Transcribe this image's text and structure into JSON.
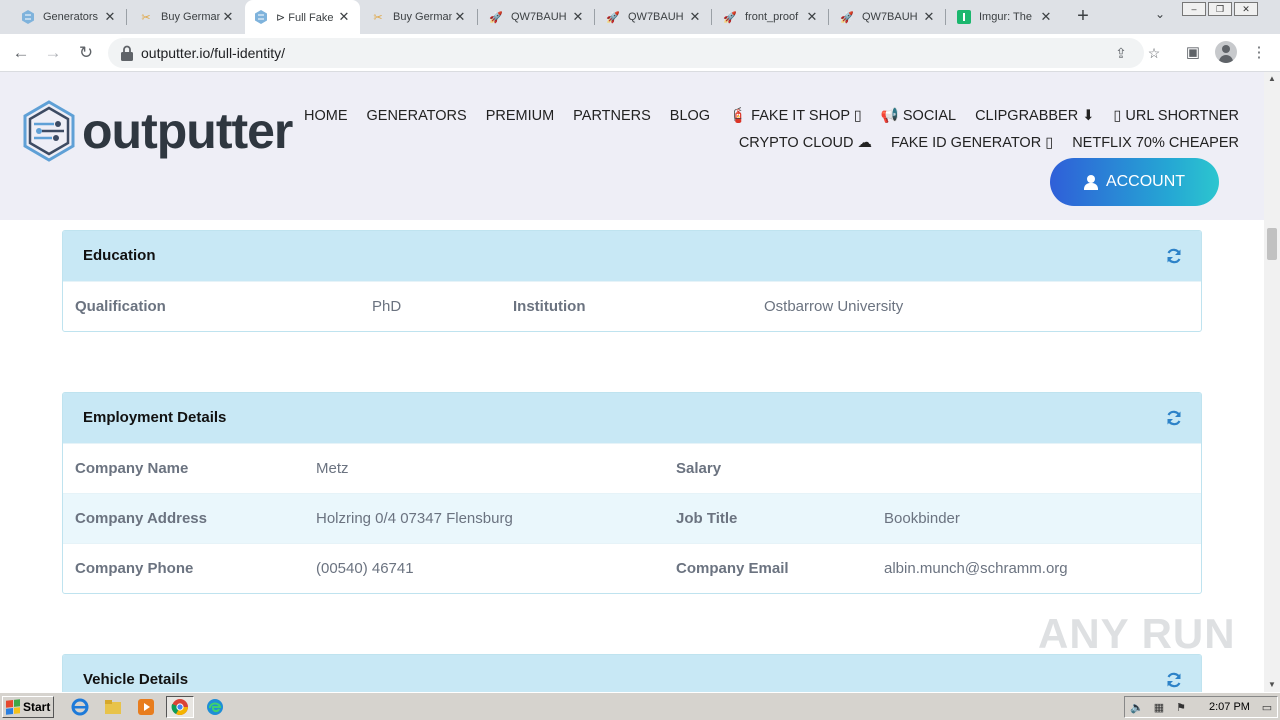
{
  "browser": {
    "tabs": [
      {
        "title": "Generators",
        "favicon": "outputter-icon",
        "active": false
      },
      {
        "title": "Buy German",
        "favicon": "shop-icon",
        "active": false
      },
      {
        "title": "⊳ Full Fake",
        "favicon": "outputter-icon",
        "active": true
      },
      {
        "title": "Buy German",
        "favicon": "shop-icon",
        "active": false
      },
      {
        "title": "QW7BAUH",
        "favicon": "rocket-icon",
        "active": false
      },
      {
        "title": "QW7BAUH",
        "favicon": "rocket-icon",
        "active": false
      },
      {
        "title": "front_proof",
        "favicon": "rocket-icon",
        "active": false
      },
      {
        "title": "QW7BAUH",
        "favicon": "rocket-icon",
        "active": false
      },
      {
        "title": "Imgur: The",
        "favicon": "imgur-icon",
        "active": false
      }
    ],
    "url": "outputter.io/full-identity/"
  },
  "site": {
    "brand": "outputter",
    "nav_row1": [
      "HOME",
      "GENERATORS",
      "PREMIUM",
      "PARTNERS",
      "BLOG",
      "🧯 FAKE IT SHOP ▯",
      "📢 SOCIAL",
      "CLIPGRABBER ⬇",
      "▯ URL SHORTNER"
    ],
    "nav_row2": [
      "CRYPTO CLOUD ☁",
      "FAKE ID GENERATOR ▯",
      "NETFLIX 70% CHEAPER"
    ],
    "account_label": "ACCOUNT"
  },
  "education": {
    "title": "Education",
    "qualification_label": "Qualification",
    "qualification": "PhD",
    "institution_label": "Institution",
    "institution": "Ostbarrow University"
  },
  "employment": {
    "title": "Employment Details",
    "company_name_label": "Company Name",
    "company_name": "Metz",
    "salary_label": "Salary",
    "salary": "",
    "company_address_label": "Company Address",
    "company_address": "Holzring 0/4 07347 Flensburg",
    "job_title_label": "Job Title",
    "job_title": "Bookbinder",
    "company_phone_label": "Company Phone",
    "company_phone": "(00540) 46741",
    "company_email_label": "Company Email",
    "company_email": "albin.munch@schramm.org"
  },
  "vehicle": {
    "title": "Vehicle Details"
  },
  "watermark": "ANY RUN",
  "taskbar": {
    "start_label": "Start",
    "clock": "2:07 PM"
  }
}
